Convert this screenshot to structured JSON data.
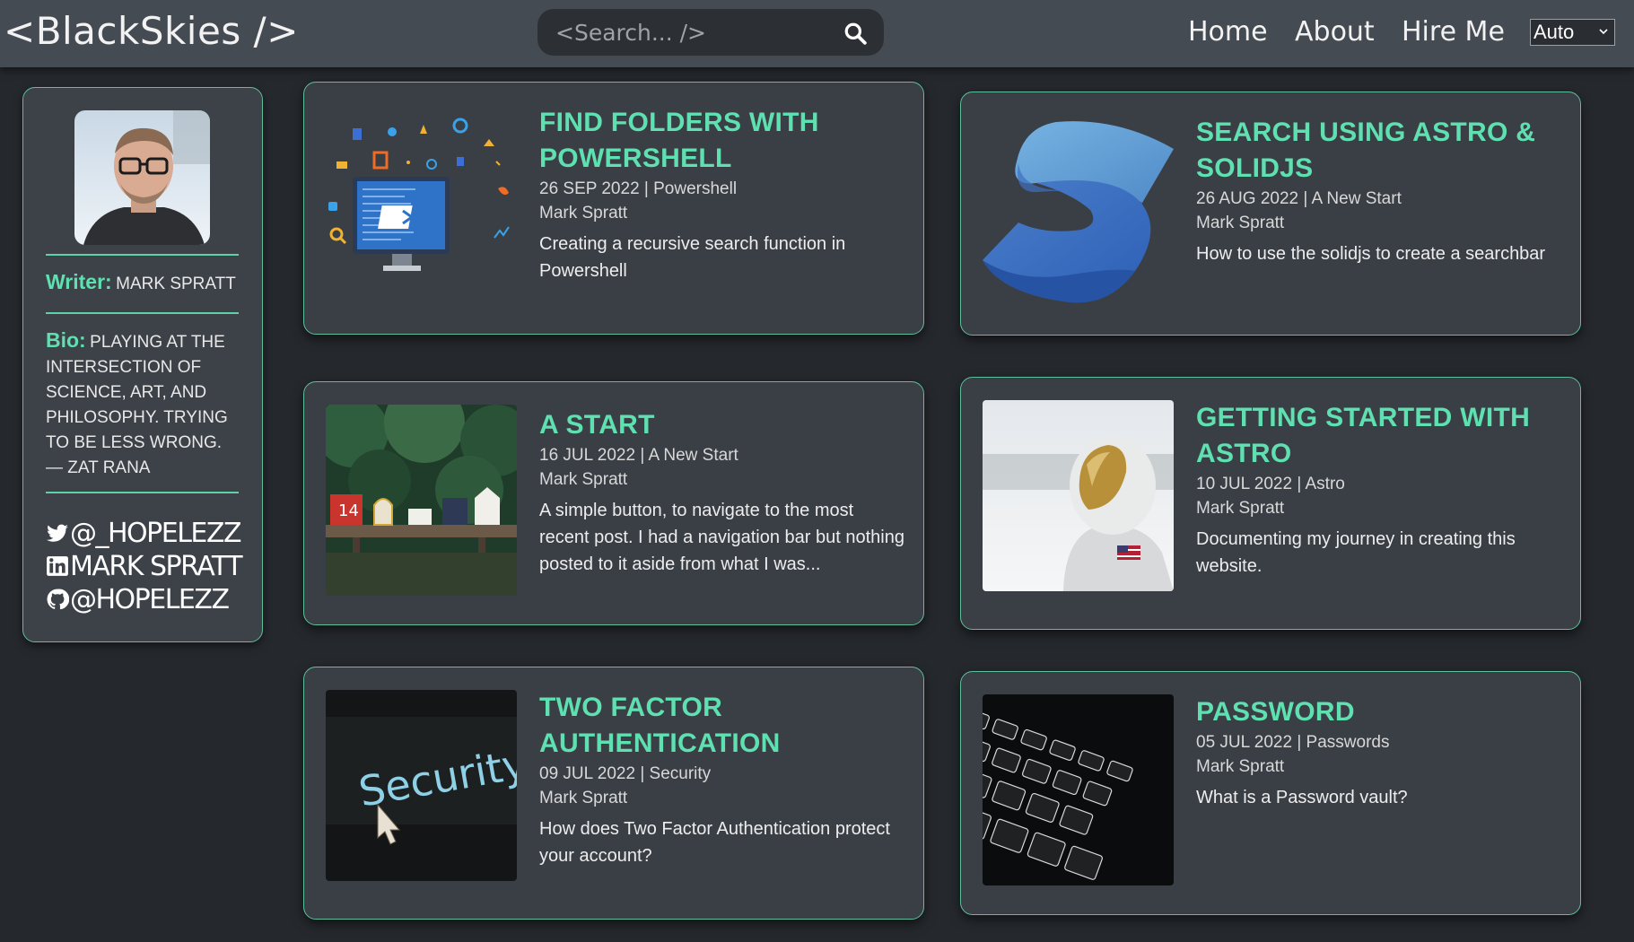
{
  "header": {
    "logo": "<BlackSkies />",
    "search_placeholder": "<Search... />",
    "nav": [
      "Home",
      "About",
      "Hire Me"
    ],
    "theme_selected": "Auto"
  },
  "sidebar": {
    "writer_label": "Writer:",
    "writer_name": "Mark Spratt",
    "bio_label": "Bio:",
    "bio_text": "Playing at the intersection of science, art, and philosophy. Trying to be less wrong. — Zat Rana",
    "twitter": "@_hopelezz",
    "linkedin": "Mark Spratt",
    "github": "@hopelezz"
  },
  "posts": [
    {
      "title": "Find Folders with Powershell",
      "meta": "26 SEP 2022 | Powershell",
      "author": "Mark Spratt",
      "desc": "Creating a recursive search function in Powershell",
      "thumb": "powershell-illustration"
    },
    {
      "title": "Search using Astro & SolidJS",
      "meta": "26 AUG 2022 | A New Start",
      "author": "Mark Spratt",
      "desc": "How to use the solidjs to create a searchbar",
      "thumb": "solidjs-logo"
    },
    {
      "title": "A Start",
      "meta": "16 JUL 2022 | A New Start",
      "author": "Mark Spratt",
      "desc": "A simple button, to navigate to the most recent post. I had a navigation bar but nothing posted to it aside from what I was...",
      "thumb": "mailboxes-photo"
    },
    {
      "title": "Getting Started with Astro",
      "meta": "10 JUL 2022 | Astro",
      "author": "Mark Spratt",
      "desc": "Documenting my journey in creating this website.",
      "thumb": "astronaut-photo"
    },
    {
      "title": "Two Factor Authentication",
      "meta": "09 JUL 2022 | Security",
      "author": "Mark Spratt",
      "desc": "How does Two Factor Authentication protect your account?",
      "thumb": "security-photo",
      "thumb_text": "Security"
    },
    {
      "title": "Password",
      "meta": "05 JUL 2022 | Passwords",
      "author": "Mark Spratt",
      "desc": "What is a Password vault?",
      "thumb": "keyboard-photo"
    }
  ],
  "colors": {
    "accent": "#5fe0b0",
    "border": "#5fbf9a",
    "header_bg": "#454b53",
    "page_bg": "#25282d",
    "card_bg": "#3a3f46"
  }
}
